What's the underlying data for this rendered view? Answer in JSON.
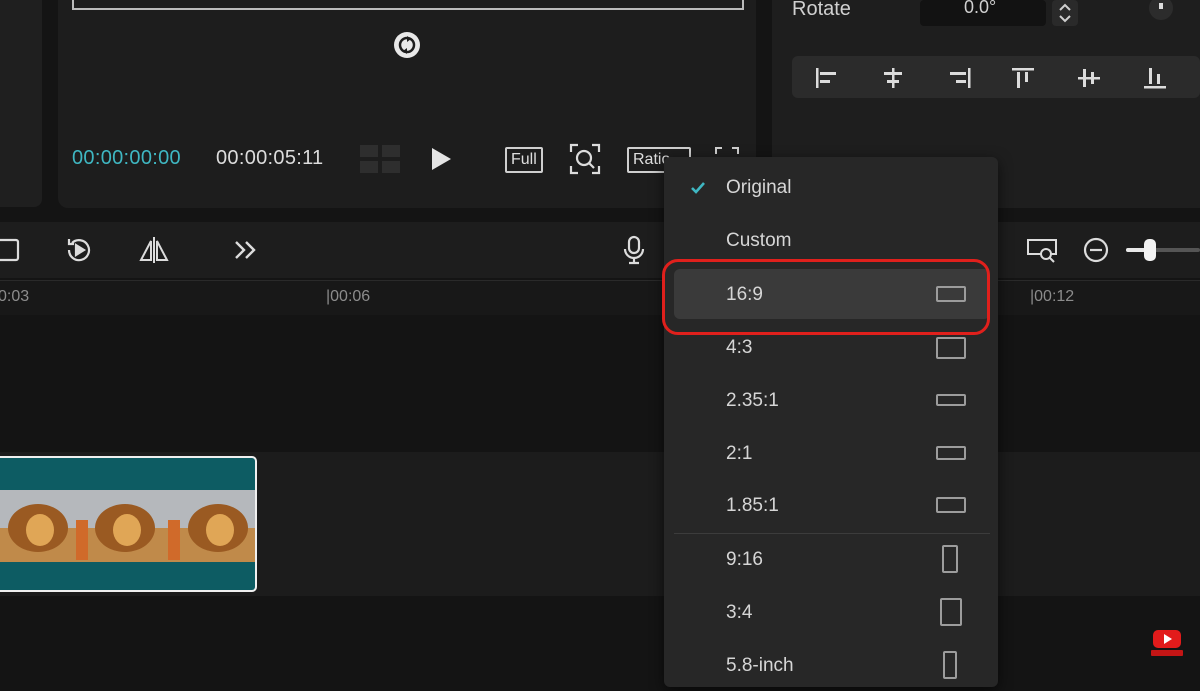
{
  "player": {
    "current_time": "00:00:00:00",
    "total_time": "00:00:05:11",
    "full_label": "Full",
    "ratio_label": "Ratio"
  },
  "properties": {
    "rotate_label": "Rotate",
    "rotate_value": "0.0°"
  },
  "timeline": {
    "ruler_labels": [
      "0:03",
      "|00:06",
      "|00:12"
    ]
  },
  "ratio_menu": {
    "items": [
      {
        "label": "Original",
        "checked": true,
        "shape": ""
      },
      {
        "label": "Custom",
        "shape": ""
      },
      {
        "label": "16:9",
        "shape": "landscape-wide-icon"
      },
      {
        "label": "4:3",
        "shape": "landscape-icon"
      },
      {
        "label": "2.35:1",
        "shape": "cinema-icon"
      },
      {
        "label": "2:1",
        "shape": "landscape-2-1-icon"
      },
      {
        "label": "1.85:1",
        "shape": "landscape-185-icon"
      },
      {
        "label": "9:16",
        "shape": "portrait-tall-icon"
      },
      {
        "label": "3:4",
        "shape": "portrait-icon"
      },
      {
        "label": "5.8-inch",
        "shape": "phone-icon"
      }
    ]
  },
  "colors": {
    "accent_time": "#3fb7c2",
    "highlight": "#e0201c",
    "clip": "#0d5c63"
  }
}
